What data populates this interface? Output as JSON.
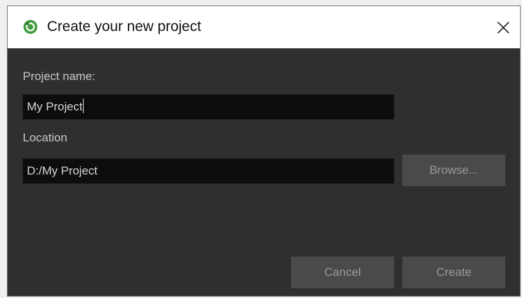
{
  "window": {
    "title": "Create your new project",
    "close_icon": "close-icon",
    "app_icon": "app-logo-icon"
  },
  "form": {
    "project_name_label": "Project name:",
    "project_name_value": "My Project",
    "location_label": "Location",
    "location_value": "D:/My Project",
    "browse_label": "Browse..."
  },
  "footer": {
    "cancel_label": "Cancel",
    "create_label": "Create"
  },
  "colors": {
    "background": "#2f2f2f",
    "field_background": "#0d0d0d",
    "button_background": "#4a4a4a",
    "titlebar_background": "#ffffff",
    "logo_green": "#3e9a3a"
  }
}
